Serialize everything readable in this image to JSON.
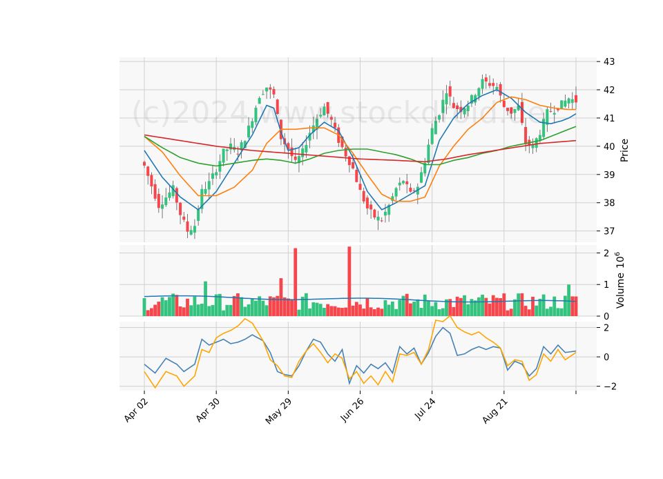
{
  "watermark": "(c)2024 www.stockdroid.de",
  "colors": {
    "up": "#33c37f",
    "down": "#f6464b",
    "ma10": "#1f77b4",
    "ma20": "#ff7f0e",
    "ma50": "#2ca02c",
    "ma200": "#d62728",
    "volume_ma": "#1f77b4",
    "osc_fast": "#4682b4",
    "osc_slow": "#ffa500",
    "panel_bg": "#f8f8f8",
    "grid": "#d0d0d0"
  },
  "chart_data": [
    {
      "panel": "price",
      "type": "candlestick",
      "ylabel": "Price",
      "ylim": [
        36.6,
        43.15
      ],
      "yticks": [
        37,
        38,
        39,
        40,
        41,
        42,
        43
      ],
      "x_tick_labels": [
        "Apr 02",
        "Apr 30",
        "May 29",
        "Jun 26",
        "Jul 24",
        "Aug 21",
        ""
      ],
      "x_tick_index": [
        0,
        20,
        40,
        60,
        80,
        100,
        120
      ],
      "grid": true,
      "ohlc_close_keypoints": [
        [
          0,
          39.3
        ],
        [
          2,
          38.6
        ],
        [
          4,
          37.9
        ],
        [
          6,
          38.2
        ],
        [
          8,
          38.5
        ],
        [
          10,
          37.6
        ],
        [
          12,
          37.0
        ],
        [
          14,
          37.2
        ],
        [
          16,
          38.4
        ],
        [
          18,
          38.7
        ],
        [
          20,
          39.2
        ],
        [
          22,
          39.8
        ],
        [
          24,
          40.0
        ],
        [
          26,
          39.8
        ],
        [
          28,
          40.3
        ],
        [
          30,
          41.0
        ],
        [
          32,
          41.8
        ],
        [
          34,
          42.1
        ],
        [
          36,
          41.8
        ],
        [
          38,
          40.3
        ],
        [
          40,
          39.9
        ],
        [
          42,
          39.4
        ],
        [
          44,
          39.8
        ],
        [
          46,
          40.5
        ],
        [
          48,
          41.0
        ],
        [
          50,
          41.4
        ],
        [
          52,
          40.9
        ],
        [
          54,
          40.2
        ],
        [
          56,
          39.7
        ],
        [
          58,
          39.2
        ],
        [
          60,
          38.4
        ],
        [
          62,
          37.8
        ],
        [
          64,
          37.5
        ],
        [
          66,
          37.4
        ],
        [
          68,
          37.9
        ],
        [
          70,
          38.5
        ],
        [
          72,
          38.8
        ],
        [
          74,
          38.3
        ],
        [
          76,
          38.6
        ],
        [
          78,
          39.5
        ],
        [
          80,
          40.6
        ],
        [
          82,
          41.2
        ],
        [
          84,
          42.0
        ],
        [
          86,
          41.4
        ],
        [
          88,
          41.3
        ],
        [
          90,
          41.5
        ],
        [
          92,
          41.9
        ],
        [
          94,
          42.3
        ],
        [
          96,
          42.2
        ],
        [
          98,
          42.1
        ],
        [
          100,
          41.4
        ],
        [
          102,
          41.2
        ],
        [
          104,
          41.4
        ],
        [
          106,
          40.1
        ],
        [
          108,
          40.0
        ],
        [
          110,
          40.5
        ],
        [
          112,
          41.2
        ],
        [
          114,
          41.3
        ],
        [
          116,
          41.5
        ],
        [
          118,
          41.7
        ],
        [
          120,
          41.6
        ]
      ],
      "moving_averages": [
        {
          "period": 10,
          "values": [
            [
              0,
              39.85
            ],
            [
              5,
              38.9
            ],
            [
              10,
              38.2
            ],
            [
              15,
              37.75
            ],
            [
              20,
              38.4
            ],
            [
              25,
              39.4
            ],
            [
              30,
              40.4
            ],
            [
              34,
              41.45
            ],
            [
              36,
              41.35
            ],
            [
              38,
              40.5
            ],
            [
              40,
              39.85
            ],
            [
              43,
              39.95
            ],
            [
              46,
              40.4
            ],
            [
              50,
              40.85
            ],
            [
              54,
              40.55
            ],
            [
              58,
              39.6
            ],
            [
              62,
              38.4
            ],
            [
              66,
              37.75
            ],
            [
              70,
              38.0
            ],
            [
              74,
              38.3
            ],
            [
              78,
              38.6
            ],
            [
              82,
              40.2
            ],
            [
              86,
              41.0
            ],
            [
              90,
              41.5
            ],
            [
              94,
              41.8
            ],
            [
              98,
              42.0
            ],
            [
              102,
              41.7
            ],
            [
              106,
              41.2
            ],
            [
              110,
              40.85
            ],
            [
              113,
              40.8
            ],
            [
              116,
              40.9
            ],
            [
              118,
              41.0
            ],
            [
              120,
              41.15
            ]
          ]
        },
        {
          "period": 20,
          "values": [
            [
              0,
              40.35
            ],
            [
              5,
              39.8
            ],
            [
              10,
              38.95
            ],
            [
              15,
              38.25
            ],
            [
              20,
              38.25
            ],
            [
              25,
              38.55
            ],
            [
              30,
              39.15
            ],
            [
              34,
              40.1
            ],
            [
              38,
              40.6
            ],
            [
              42,
              40.6
            ],
            [
              46,
              40.65
            ],
            [
              50,
              40.65
            ],
            [
              54,
              40.4
            ],
            [
              58,
              39.75
            ],
            [
              62,
              39.0
            ],
            [
              66,
              38.3
            ],
            [
              70,
              38.05
            ],
            [
              74,
              38.05
            ],
            [
              78,
              38.2
            ],
            [
              82,
              39.3
            ],
            [
              86,
              40.0
            ],
            [
              90,
              40.6
            ],
            [
              94,
              41.0
            ],
            [
              98,
              41.55
            ],
            [
              102,
              41.75
            ],
            [
              106,
              41.65
            ],
            [
              110,
              41.45
            ],
            [
              114,
              41.35
            ],
            [
              118,
              41.3
            ],
            [
              120,
              41.3
            ]
          ]
        },
        {
          "period": 50,
          "values": [
            [
              0,
              40.35
            ],
            [
              5,
              39.95
            ],
            [
              10,
              39.6
            ],
            [
              15,
              39.4
            ],
            [
              20,
              39.3
            ],
            [
              25,
              39.4
            ],
            [
              30,
              39.5
            ],
            [
              34,
              39.55
            ],
            [
              38,
              39.5
            ],
            [
              42,
              39.4
            ],
            [
              46,
              39.55
            ],
            [
              50,
              39.75
            ],
            [
              54,
              39.85
            ],
            [
              58,
              39.9
            ],
            [
              62,
              39.9
            ],
            [
              66,
              39.8
            ],
            [
              70,
              39.7
            ],
            [
              74,
              39.55
            ],
            [
              78,
              39.35
            ],
            [
              82,
              39.35
            ],
            [
              86,
              39.5
            ],
            [
              90,
              39.6
            ],
            [
              94,
              39.75
            ],
            [
              98,
              39.85
            ],
            [
              102,
              40.0
            ],
            [
              106,
              40.1
            ],
            [
              110,
              40.2
            ],
            [
              114,
              40.4
            ],
            [
              118,
              40.6
            ],
            [
              120,
              40.7
            ]
          ]
        },
        {
          "period": 200,
          "values": [
            [
              0,
              40.4
            ],
            [
              10,
              40.2
            ],
            [
              20,
              40.0
            ],
            [
              30,
              39.85
            ],
            [
              40,
              39.75
            ],
            [
              50,
              39.65
            ],
            [
              60,
              39.55
            ],
            [
              70,
              39.5
            ],
            [
              78,
              39.45
            ],
            [
              84,
              39.55
            ],
            [
              90,
              39.7
            ],
            [
              100,
              39.9
            ],
            [
              110,
              40.1
            ],
            [
              120,
              40.2
            ]
          ]
        }
      ]
    },
    {
      "panel": "volume",
      "type": "bar",
      "ylabel": "Volume",
      "scale_label": "10",
      "scale_exponent": "6",
      "ylim": [
        0,
        2.25
      ],
      "yticks": [
        0,
        1,
        2
      ],
      "tall_bars": [
        [
          42,
          2.15
        ],
        [
          57,
          2.2
        ],
        [
          118,
          1.0
        ],
        [
          38,
          1.2
        ],
        [
          17,
          1.1
        ]
      ],
      "volume_ma": 0.62
    },
    {
      "panel": "oscillator",
      "type": "line",
      "ylim": [
        -2.3,
        2.4
      ],
      "yticks": [
        -2,
        0,
        2
      ],
      "series": [
        {
          "values": [
            [
              0,
              -0.5
            ],
            [
              3,
              -1.1
            ],
            [
              6,
              -0.1
            ],
            [
              9,
              -0.5
            ],
            [
              11,
              -1.0
            ],
            [
              14,
              -0.5
            ],
            [
              16,
              1.2
            ],
            [
              18,
              0.8
            ],
            [
              20,
              1.0
            ],
            [
              22,
              1.2
            ],
            [
              24,
              0.9
            ],
            [
              26,
              1.0
            ],
            [
              28,
              1.2
            ],
            [
              30,
              1.5
            ],
            [
              33,
              1.1
            ],
            [
              35,
              0.3
            ],
            [
              37,
              -1.0
            ],
            [
              39,
              -1.2
            ],
            [
              41,
              -1.3
            ],
            [
              43,
              -0.6
            ],
            [
              45,
              0.4
            ],
            [
              47,
              1.2
            ],
            [
              49,
              1.0
            ],
            [
              51,
              0.2
            ],
            [
              53,
              -0.3
            ],
            [
              55,
              0.5
            ],
            [
              57,
              -1.8
            ],
            [
              59,
              -0.6
            ],
            [
              61,
              -1.1
            ],
            [
              63,
              -0.5
            ],
            [
              65,
              -0.8
            ],
            [
              67,
              -0.4
            ],
            [
              69,
              -1.1
            ],
            [
              71,
              0.7
            ],
            [
              73,
              0.2
            ],
            [
              75,
              0.6
            ],
            [
              77,
              -0.5
            ],
            [
              79,
              0.3
            ],
            [
              81,
              1.4
            ],
            [
              83,
              2.0
            ],
            [
              85,
              1.6
            ],
            [
              87,
              0.1
            ],
            [
              89,
              0.2
            ],
            [
              91,
              0.5
            ],
            [
              93,
              0.7
            ],
            [
              95,
              0.5
            ],
            [
              97,
              0.7
            ],
            [
              99,
              0.6
            ],
            [
              101,
              -0.9
            ],
            [
              103,
              -0.3
            ],
            [
              105,
              -0.5
            ],
            [
              107,
              -1.3
            ],
            [
              109,
              -0.8
            ],
            [
              111,
              0.7
            ],
            [
              113,
              0.2
            ],
            [
              115,
              0.8
            ],
            [
              117,
              0.3
            ],
            [
              120,
              0.4
            ]
          ]
        },
        {
          "values": [
            [
              0,
              -1.0
            ],
            [
              3,
              -2.1
            ],
            [
              6,
              -1.0
            ],
            [
              9,
              -1.3
            ],
            [
              11,
              -2.0
            ],
            [
              14,
              -1.3
            ],
            [
              16,
              0.5
            ],
            [
              18,
              0.3
            ],
            [
              20,
              1.3
            ],
            [
              22,
              1.6
            ],
            [
              24,
              1.8
            ],
            [
              26,
              2.1
            ],
            [
              28,
              2.6
            ],
            [
              30,
              2.3
            ],
            [
              33,
              1.1
            ],
            [
              35,
              -0.2
            ],
            [
              37,
              -0.6
            ],
            [
              39,
              -1.3
            ],
            [
              41,
              -1.4
            ],
            [
              43,
              -0.3
            ],
            [
              45,
              0.4
            ],
            [
              47,
              0.9
            ],
            [
              49,
              0.3
            ],
            [
              51,
              -0.4
            ],
            [
              53,
              0.2
            ],
            [
              55,
              -0.1
            ],
            [
              57,
              -1.5
            ],
            [
              59,
              -1.0
            ],
            [
              61,
              -1.8
            ],
            [
              63,
              -1.3
            ],
            [
              65,
              -1.9
            ],
            [
              67,
              -1.0
            ],
            [
              69,
              -1.7
            ],
            [
              71,
              0.2
            ],
            [
              73,
              0.1
            ],
            [
              75,
              0.3
            ],
            [
              77,
              -0.5
            ],
            [
              79,
              0.5
            ],
            [
              81,
              2.5
            ],
            [
              83,
              2.4
            ],
            [
              85,
              2.8
            ],
            [
              87,
              2.0
            ],
            [
              89,
              1.7
            ],
            [
              91,
              1.5
            ],
            [
              93,
              1.7
            ],
            [
              95,
              1.3
            ],
            [
              97,
              1.0
            ],
            [
              99,
              0.6
            ],
            [
              101,
              -0.6
            ],
            [
              103,
              -0.2
            ],
            [
              105,
              -0.3
            ],
            [
              107,
              -1.6
            ],
            [
              109,
              -1.2
            ],
            [
              111,
              0.2
            ],
            [
              113,
              -0.3
            ],
            [
              115,
              0.5
            ],
            [
              117,
              -0.2
            ],
            [
              120,
              0.3
            ]
          ]
        }
      ]
    }
  ]
}
